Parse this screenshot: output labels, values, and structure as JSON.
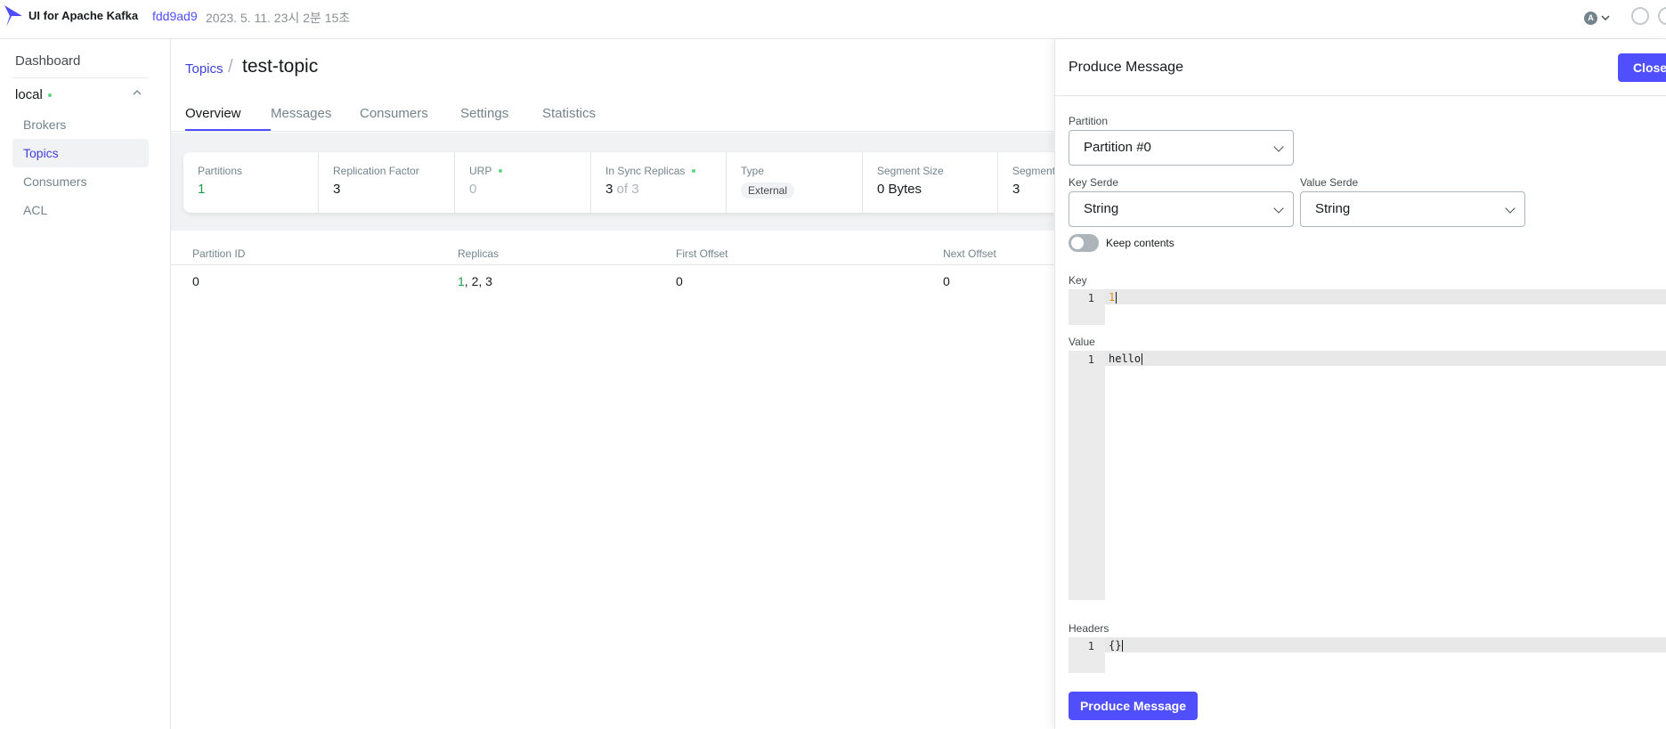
{
  "header": {
    "app_title": "UI for Apache Kafka",
    "version": "fdd9ad9",
    "build_date": "2023. 5. 11. 23시 2분 15초",
    "user_initial": "A"
  },
  "sidebar": {
    "dashboard": "Dashboard",
    "cluster": "local",
    "items": [
      {
        "label": "Brokers",
        "active": false
      },
      {
        "label": "Topics",
        "active": true
      },
      {
        "label": "Consumers",
        "active": false
      },
      {
        "label": "ACL",
        "active": false
      }
    ]
  },
  "breadcrumb": {
    "parent": "Topics",
    "separator": "/",
    "current": "test-topic"
  },
  "tabs": [
    {
      "label": "Overview",
      "active": true
    },
    {
      "label": "Messages",
      "active": false
    },
    {
      "label": "Consumers",
      "active": false
    },
    {
      "label": "Settings",
      "active": false
    },
    {
      "label": "Statistics",
      "active": false
    }
  ],
  "stats": {
    "partitions": {
      "label": "Partitions",
      "value": "1"
    },
    "replication": {
      "label": "Replication Factor",
      "value": "3"
    },
    "urp": {
      "label": "URP",
      "value": "0"
    },
    "in_sync": {
      "label": "In Sync Replicas",
      "value": "3",
      "suffix": "of 3"
    },
    "type": {
      "label": "Type",
      "value": "External"
    },
    "segment_size": {
      "label": "Segment Size",
      "value": "0 Bytes"
    },
    "segment_count": {
      "label": "Segment",
      "value": "3"
    }
  },
  "table": {
    "headers": [
      "Partition ID",
      "Replicas",
      "First Offset",
      "Next Offset"
    ],
    "rows": [
      {
        "partition_id": "0",
        "replica_leader": "1",
        "replicas_rest": ", 2, 3",
        "first_offset": "0",
        "next_offset": "0"
      }
    ]
  },
  "produce_panel": {
    "title": "Produce Message",
    "close_label": "Close",
    "partition_label": "Partition",
    "partition_value": "Partition #0",
    "key_serde_label": "Key Serde",
    "key_serde_value": "String",
    "value_serde_label": "Value Serde",
    "value_serde_value": "String",
    "keep_contents_label": "Keep contents",
    "keep_contents_on": false,
    "key_label": "Key",
    "key_line": "1",
    "key_content": "1",
    "value_label": "Value",
    "value_line": "1",
    "value_content": "hello",
    "headers_label": "Headers",
    "headers_line": "1",
    "headers_content": "{}",
    "submit_label": "Produce Message"
  },
  "colors": {
    "accent": "#4f4ffe",
    "link": "#3f3fdb",
    "status_green": "#5cd685",
    "text_muted": "#73848c"
  }
}
